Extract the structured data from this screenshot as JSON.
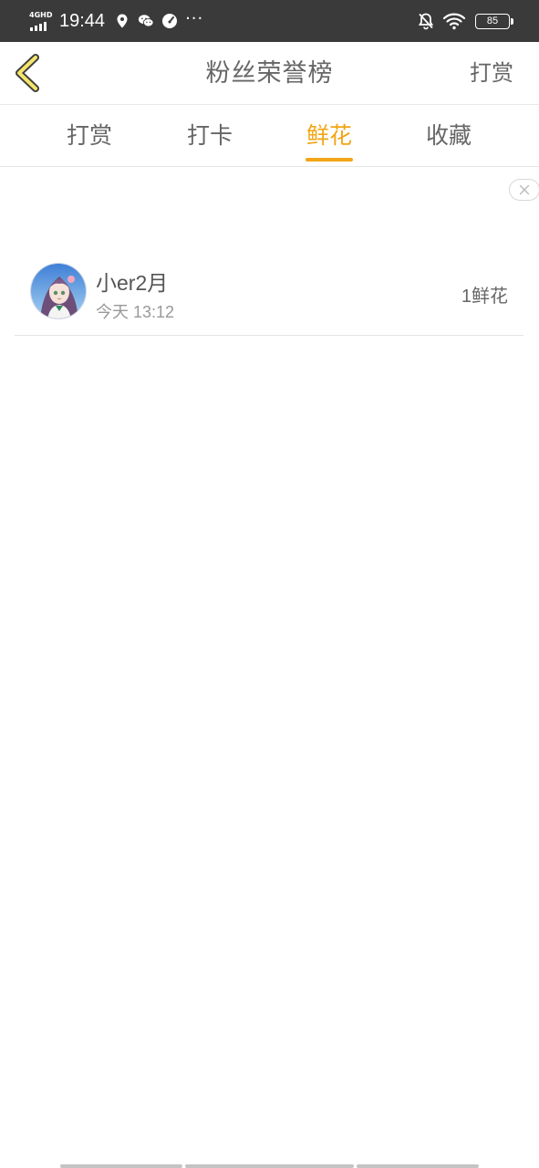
{
  "status_bar": {
    "network": "4GHD",
    "time": "19:44",
    "dots": "···",
    "battery": "85"
  },
  "header": {
    "title": "粉丝荣誉榜",
    "action_label": "打赏"
  },
  "tabs": [
    {
      "label": "打赏",
      "active": false
    },
    {
      "label": "打卡",
      "active": false
    },
    {
      "label": "鲜花",
      "active": true
    },
    {
      "label": "收藏",
      "active": false
    }
  ],
  "list": {
    "items": [
      {
        "name": "小er2月",
        "time": "今天 13:12",
        "count": "1鲜花"
      }
    ]
  },
  "colors": {
    "accent": "#f2a516",
    "status_bar": "#3a3a3a",
    "text_primary": "#555555",
    "text_secondary": "#999999"
  }
}
